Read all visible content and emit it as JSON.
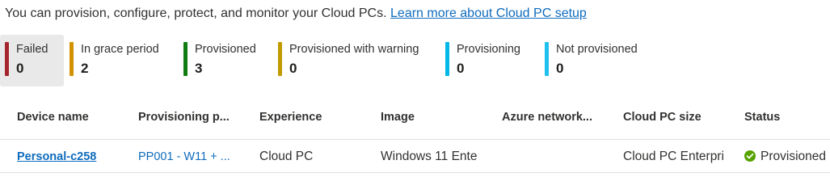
{
  "intro": {
    "text": "You can provision, configure, protect, and monitor your Cloud PCs.",
    "link": "Learn more about Cloud PC setup"
  },
  "tiles": [
    {
      "label": "Failed",
      "count": "0",
      "color": "#a4262c",
      "selected": true
    },
    {
      "label": "In grace period",
      "count": "2",
      "color": "#d29200"
    },
    {
      "label": "Provisioned",
      "count": "3",
      "color": "#107c10"
    },
    {
      "label": "Provisioned with warning",
      "count": "0",
      "color": "#c19c00"
    },
    {
      "label": "Provisioning",
      "count": "0",
      "color": "#00b7e8"
    },
    {
      "label": "Not provisioned",
      "count": "0",
      "color": "#1fbfee"
    }
  ],
  "table": {
    "columns": [
      "Device name",
      "Provisioning p...",
      "Experience",
      "Image",
      "Azure network...",
      "Cloud PC size",
      "Status"
    ],
    "rows": [
      {
        "device": "Personal-c258",
        "provisioning": "PP001 - W11 + ...",
        "experience": "Cloud PC",
        "image": "Windows 11 Ente",
        "network": "",
        "size": "Cloud PC Enterpri",
        "status": "Provisioned",
        "status_color": "#57a300"
      }
    ]
  }
}
